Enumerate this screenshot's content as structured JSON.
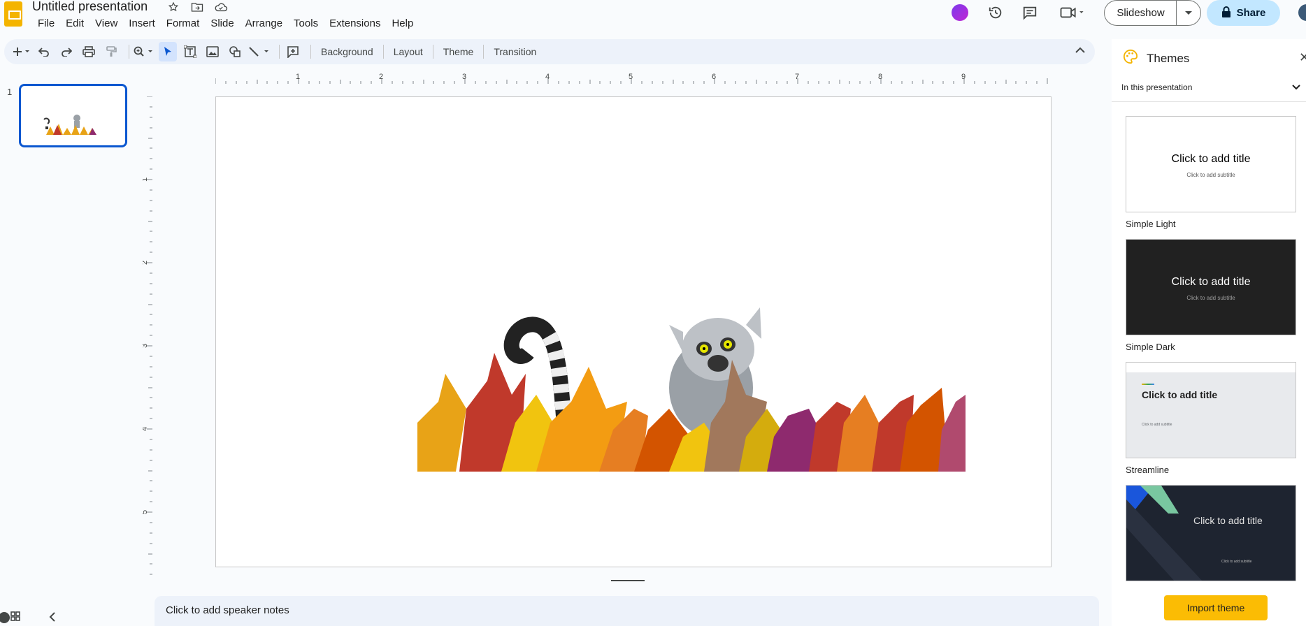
{
  "app": {
    "doc_title": "Untitled presentation",
    "menu": [
      "File",
      "Edit",
      "View",
      "Insert",
      "Format",
      "Slide",
      "Arrange",
      "Tools",
      "Extensions",
      "Help"
    ]
  },
  "header": {
    "slideshow_label": "Slideshow",
    "share_label": "Share"
  },
  "toolbar": {
    "background_label": "Background",
    "layout_label": "Layout",
    "theme_label": "Theme",
    "transition_label": "Transition"
  },
  "filmstrip": {
    "slides": [
      {
        "number": "1"
      }
    ]
  },
  "ruler": {
    "h_labels": [
      "1",
      "2",
      "3",
      "4",
      "5",
      "6",
      "7",
      "8",
      "9"
    ],
    "v_labels": [
      "1",
      "2",
      "3",
      "4",
      "5"
    ]
  },
  "notes": {
    "placeholder": "Click to add speaker notes"
  },
  "themes": {
    "panel_title": "Themes",
    "filter_label": "In this presentation",
    "items": [
      {
        "name": "Simple Light",
        "title": "Click to add title",
        "subtitle": "Click to add subtitle"
      },
      {
        "name": "Simple Dark",
        "title": "Click to add title",
        "subtitle": "Click to add subtitle"
      },
      {
        "name": "Streamline",
        "title": "Click to add title",
        "subtitle": "Click to add subtitle"
      },
      {
        "name": "",
        "title": "Click to add title",
        "subtitle": "Click to add subtitle"
      }
    ],
    "import_label": "Import theme"
  },
  "colors": {
    "accent": "#0b57d0",
    "share_bg": "#c2e7ff",
    "import_bg": "#fbbc04",
    "toolbar_bg": "#edf2fa"
  }
}
